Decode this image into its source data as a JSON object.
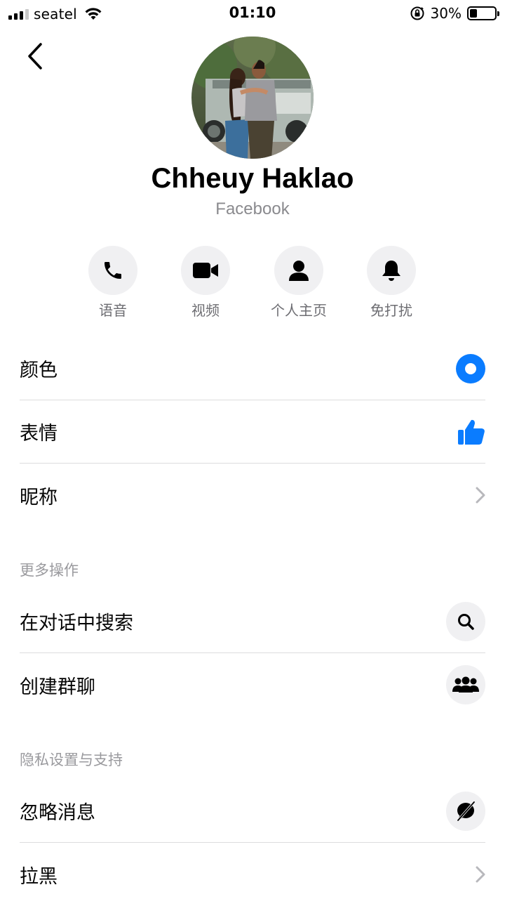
{
  "status_bar": {
    "carrier": "seatel",
    "time": "01:10",
    "battery_percent": "30%",
    "battery_level": 0.3
  },
  "profile": {
    "name": "Chheuy Haklao",
    "subtitle": "Facebook"
  },
  "actions": [
    {
      "label": "语音",
      "icon": "phone-icon"
    },
    {
      "label": "视频",
      "icon": "video-icon"
    },
    {
      "label": "个人主页",
      "icon": "person-icon"
    },
    {
      "label": "免打扰",
      "icon": "bell-icon"
    }
  ],
  "settings": {
    "color_label": "颜色",
    "emoji_label": "表情",
    "nickname_label": "昵称"
  },
  "more_actions": {
    "header": "更多操作",
    "search_label": "在对话中搜索",
    "group_label": "创建群聊"
  },
  "privacy": {
    "header": "隐私设置与支持",
    "ignore_label": "忽略消息",
    "block_label": "拉黑"
  },
  "colors": {
    "accent": "#0a7cff",
    "secondary_text": "#8a8a8e",
    "icon_bg": "#f0f0f2"
  }
}
